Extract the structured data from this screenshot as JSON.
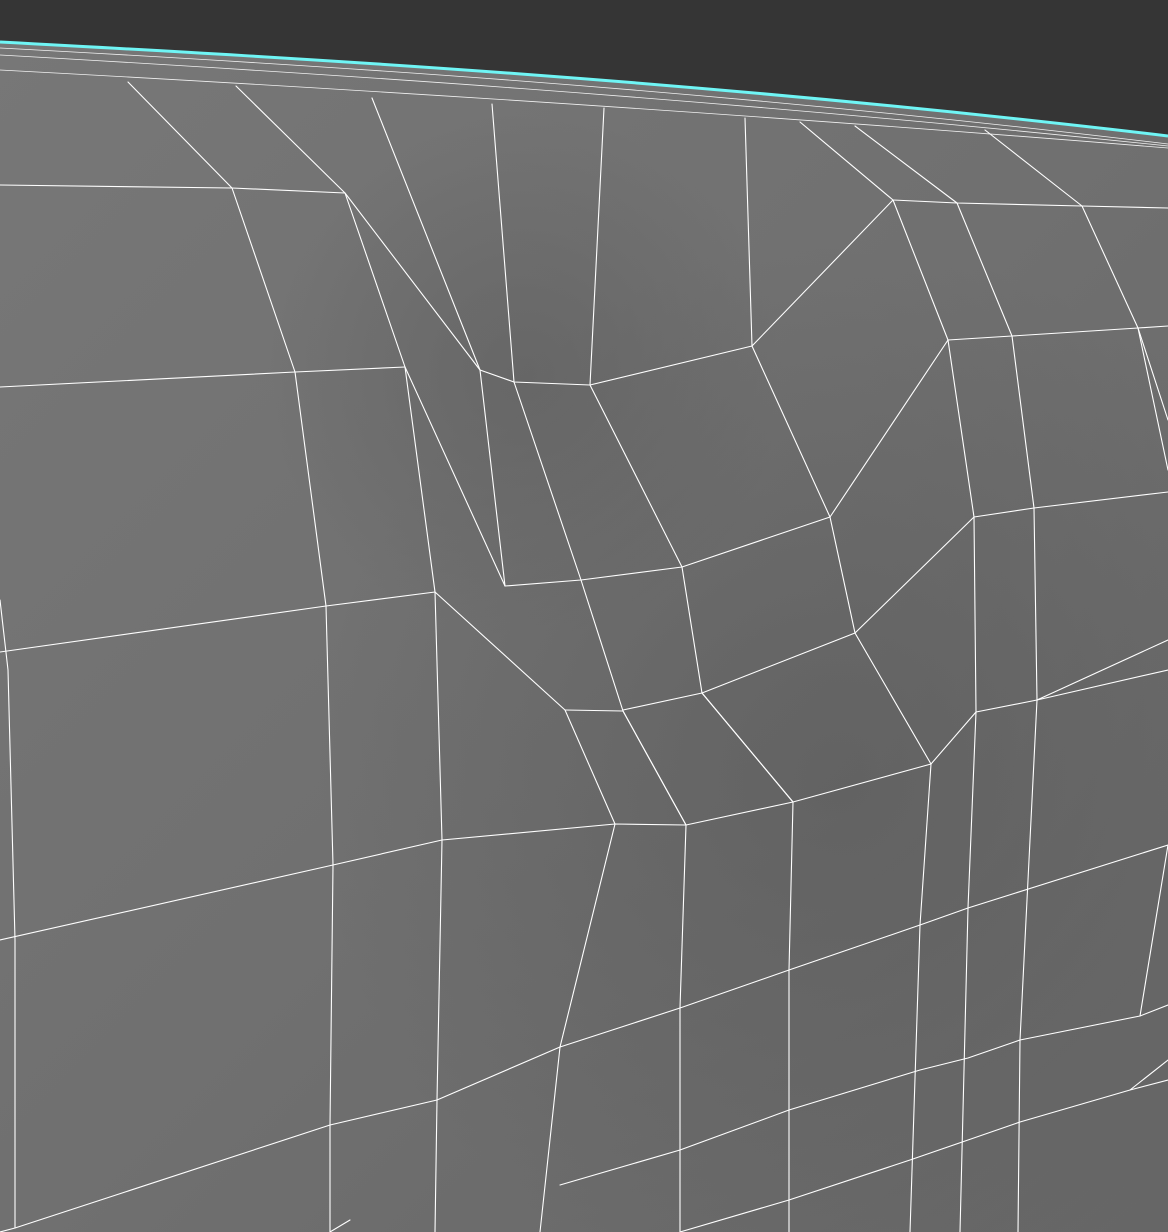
{
  "viewport": {
    "background_color": "#353535",
    "mesh_surface_color": "#717171",
    "mesh_shadow_color": "#5c5c5c",
    "wireframe_color": "#ffffff",
    "selected_edge_color": "#6ff5f5"
  }
}
